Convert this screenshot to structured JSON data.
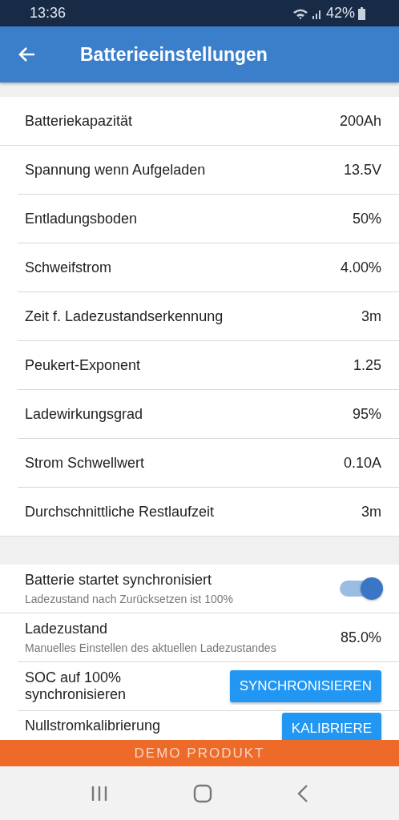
{
  "status_bar": {
    "time": "13:36",
    "battery": "42%"
  },
  "app_bar": {
    "title": "Batterieeinstellungen"
  },
  "settings": [
    {
      "label": "Batteriekapazität",
      "value": "200Ah"
    },
    {
      "label": "Spannung wenn Aufgeladen",
      "value": "13.5V"
    },
    {
      "label": "Entladungsboden",
      "value": "50%"
    },
    {
      "label": "Schweifstrom",
      "value": "4.00%"
    },
    {
      "label": "Zeit f. Ladezustandserkennung",
      "value": "3m"
    },
    {
      "label": "Peukert-Exponent",
      "value": "1.25"
    },
    {
      "label": "Ladewirkungsgrad",
      "value": "95%"
    },
    {
      "label": "Strom Schwellwert",
      "value": "0.10A"
    },
    {
      "label": "Durchschnittliche Restlaufzeit",
      "value": "3m"
    }
  ],
  "sync_settings": [
    {
      "kind": "toggle",
      "label": "Batterie startet synchronisiert",
      "subtitle": "Ladezustand nach Zurücksetzen ist 100%",
      "checked": true
    },
    {
      "kind": "value",
      "label": "Ladezustand",
      "subtitle": "Manuelles Einstellen des aktuellen Ladezustandes",
      "value": "85.0%"
    },
    {
      "kind": "button",
      "label": "SOC auf 100% synchronisieren",
      "button": "SYNCHRONISIEREN"
    },
    {
      "kind": "button",
      "label": "Nullstromkalibrierung",
      "button": "KALIBRIERE"
    }
  ],
  "banner": "DEMO PRODUKT"
}
